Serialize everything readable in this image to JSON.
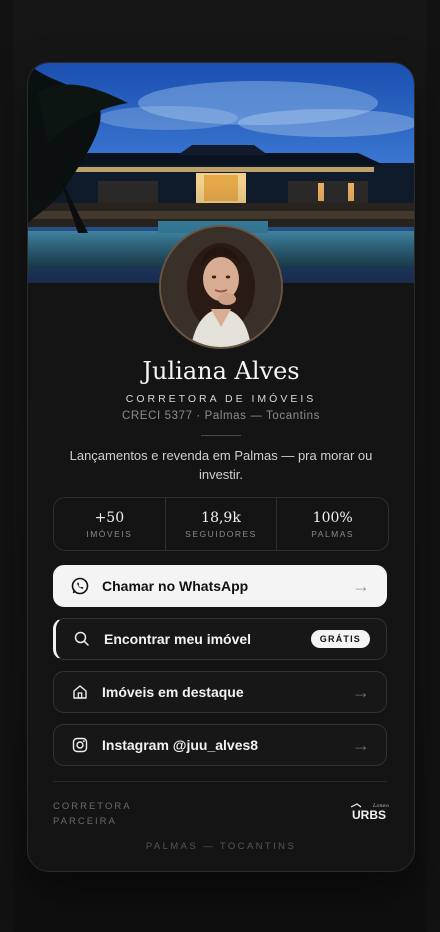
{
  "profile": {
    "name": "Juliana Alves",
    "role": "CORRETORA DE IMÓVEIS",
    "creci": "CRECI 5377 · Palmas — Tocantins",
    "bio": "Lançamentos e revenda em Palmas — pra morar ou investir."
  },
  "stats": [
    {
      "value": "+50",
      "label": "IMÓVEIS"
    },
    {
      "value": "18,9k",
      "label": "SEGUIDORES"
    },
    {
      "value": "100%",
      "label": "PALMAS"
    }
  ],
  "links": {
    "whatsapp": {
      "label": "Chamar no WhatsApp",
      "icon": "whatsapp-icon",
      "arrow": "→"
    },
    "find": {
      "label": "Encontrar meu imóvel",
      "icon": "search-icon",
      "badge": "GRÁTIS"
    },
    "featured": {
      "label": "Imóveis em destaque",
      "icon": "home-icon",
      "arrow": "→"
    },
    "instagram": {
      "label": "Instagram @juu_alves8",
      "icon": "instagram-icon",
      "arrow": "→"
    }
  },
  "partner": {
    "label": "CORRETORA PARCEIRA",
    "logo_text": "URBS",
    "logo_script": "Lonecek"
  },
  "footer": "PALMAS — TOCANTINS",
  "colors": {
    "background": "#121212",
    "card": "#141414",
    "primary_button": "#f4f4f4",
    "sky": "#1f5fb8"
  }
}
